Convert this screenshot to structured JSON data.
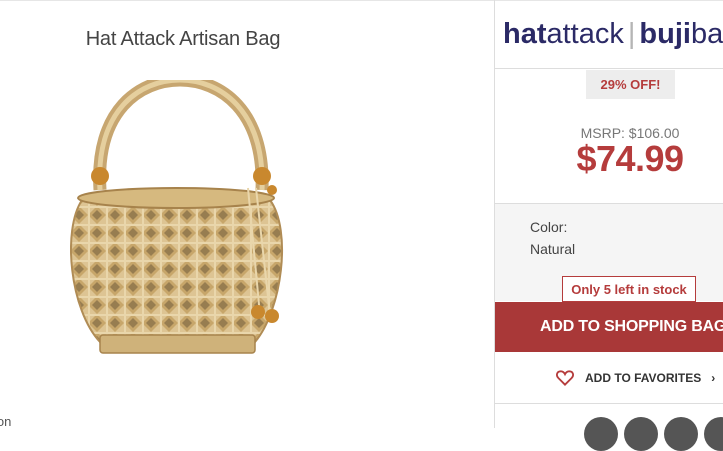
{
  "product": {
    "title": "Hat Attack Artisan Bag",
    "image_alt": "woven bamboo basket bag"
  },
  "brand": {
    "part1_bold": "hat",
    "part1_rest": "attack",
    "separator": "|",
    "part2_bold": "buji",
    "part2_rest": "ba"
  },
  "pricing": {
    "discount": "29% OFF!",
    "msrp": "MSRP: $106.00",
    "price": "$74.99"
  },
  "options": {
    "color_label": "Color:",
    "color_value": "Natural",
    "stock": "Only 5 left in stock"
  },
  "actions": {
    "add_to_bag": "ADD TO SHOPPING BAG",
    "add_to_bag_chevron": "›",
    "add_to_favorites": "ADD TO FAVORITES",
    "favorites_chevron": "›"
  },
  "cut_text": "ion",
  "colors": {
    "accent": "#b53c3c",
    "button": "#a93838",
    "brand": "#2b2a66"
  }
}
